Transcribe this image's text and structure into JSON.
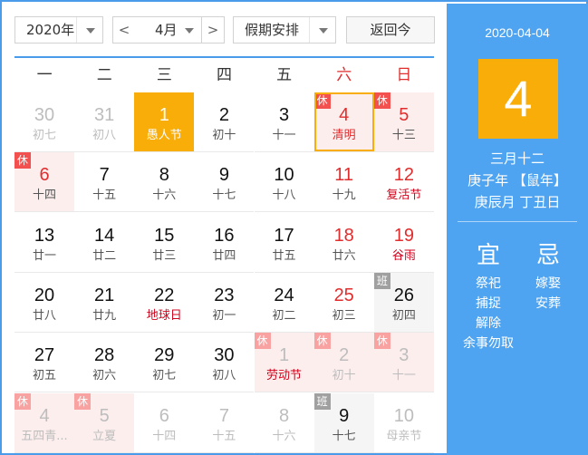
{
  "toolbar": {
    "year_value": "2020年",
    "prev_label": "<",
    "month_value": "4月",
    "next_label": ">",
    "holiday_value": "假期安排",
    "today_label": "返回今"
  },
  "weekdays": [
    "一",
    "二",
    "三",
    "四",
    "五",
    "六",
    "日"
  ],
  "badges": {
    "rest": "休",
    "work": "班"
  },
  "days": [
    {
      "n": "30",
      "l": "初七",
      "other": true
    },
    {
      "n": "31",
      "l": "初八",
      "other": true
    },
    {
      "n": "1",
      "l": "愚人节",
      "selected": true
    },
    {
      "n": "2",
      "l": "初十"
    },
    {
      "n": "3",
      "l": "十一"
    },
    {
      "n": "4",
      "l": "清明",
      "weekend": true,
      "rest": true,
      "today": true
    },
    {
      "n": "5",
      "l": "十三",
      "weekend": true,
      "rest": true
    },
    {
      "n": "6",
      "l": "十四",
      "weekend": true,
      "rest": true
    },
    {
      "n": "7",
      "l": "十五"
    },
    {
      "n": "8",
      "l": "十六"
    },
    {
      "n": "9",
      "l": "十七"
    },
    {
      "n": "10",
      "l": "十八"
    },
    {
      "n": "11",
      "l": "十九",
      "weekend": true
    },
    {
      "n": "12",
      "l": "复活节",
      "weekend": true,
      "festival": true
    },
    {
      "n": "13",
      "l": "廿一"
    },
    {
      "n": "14",
      "l": "廿二"
    },
    {
      "n": "15",
      "l": "廿三"
    },
    {
      "n": "16",
      "l": "廿四"
    },
    {
      "n": "17",
      "l": "廿五"
    },
    {
      "n": "18",
      "l": "廿六",
      "weekend": true
    },
    {
      "n": "19",
      "l": "谷雨",
      "weekend": true,
      "festival": true
    },
    {
      "n": "20",
      "l": "廿八"
    },
    {
      "n": "21",
      "l": "廿九"
    },
    {
      "n": "22",
      "l": "地球日",
      "festival": true
    },
    {
      "n": "23",
      "l": "初一"
    },
    {
      "n": "24",
      "l": "初二"
    },
    {
      "n": "25",
      "l": "初三",
      "weekend": true
    },
    {
      "n": "26",
      "l": "初四",
      "work": true
    },
    {
      "n": "27",
      "l": "初五"
    },
    {
      "n": "28",
      "l": "初六"
    },
    {
      "n": "29",
      "l": "初七"
    },
    {
      "n": "30",
      "l": "初八"
    },
    {
      "n": "1",
      "l": "劳动节",
      "other": true,
      "rest": true,
      "festival": true
    },
    {
      "n": "2",
      "l": "初十",
      "other": true,
      "rest": true
    },
    {
      "n": "3",
      "l": "十一",
      "other": true,
      "rest": true
    },
    {
      "n": "4",
      "l": "五四青...",
      "other": true,
      "rest": true
    },
    {
      "n": "5",
      "l": "立夏",
      "other": true,
      "rest": true
    },
    {
      "n": "6",
      "l": "十四",
      "other": true
    },
    {
      "n": "7",
      "l": "十五",
      "other": true
    },
    {
      "n": "8",
      "l": "十六",
      "other": true
    },
    {
      "n": "9",
      "l": "十七",
      "work": true,
      "workdark": true
    },
    {
      "n": "10",
      "l": "母亲节",
      "other": true
    }
  ],
  "panel": {
    "date": "2020-04-04",
    "day": "4",
    "lunar_date": "三月十二",
    "ganzhi_year": "庚子年 【鼠年】",
    "ganzhi_month_day": "庚辰月 丁丑日",
    "yi_title": "宜",
    "ji_title": "忌",
    "yi_items": [
      "祭祀",
      "捕捉",
      "解除",
      "余事勿取"
    ],
    "ji_items": [
      "嫁娶",
      "安葬"
    ]
  },
  "colors": {
    "accent_blue": "#4a9bea",
    "panel_blue": "#4ea4f0",
    "highlight_orange": "#f9ad08",
    "holiday_red": "#e02d2d",
    "rest_bg": "#fdeeee"
  }
}
